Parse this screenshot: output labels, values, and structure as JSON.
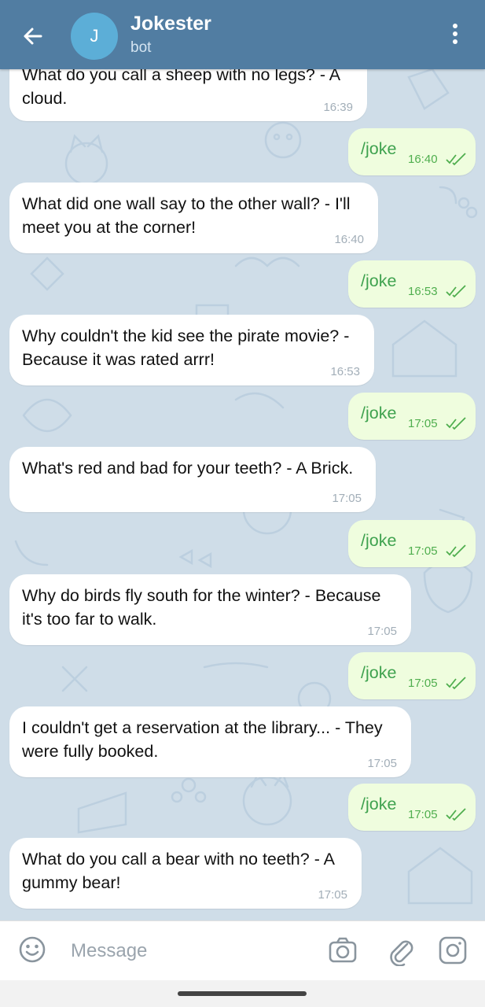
{
  "header": {
    "back_icon": "arrow-left-icon",
    "avatar_letter": "J",
    "title": "Jokester",
    "subtitle": "bot",
    "menu_icon": "more-vertical-icon",
    "color": "#517da2"
  },
  "messages": [
    {
      "type": "in",
      "text": "What do you call a sheep with no legs? - A cloud.",
      "time": "16:39"
    },
    {
      "type": "out",
      "text": "/joke",
      "time": "16:40"
    },
    {
      "type": "in",
      "text": "What did one wall say to the other wall? - I'll meet you at the corner!",
      "time": "16:40"
    },
    {
      "type": "out",
      "text": "/joke",
      "time": "16:53"
    },
    {
      "type": "in",
      "text": "Why couldn't the kid see the pirate movie? - Because it was rated arrr!",
      "time": "16:53"
    },
    {
      "type": "out",
      "text": "/joke",
      "time": "17:05"
    },
    {
      "type": "in",
      "text": "What's red and bad for your teeth? - A Brick.",
      "time": "17:05"
    },
    {
      "type": "out",
      "text": "/joke",
      "time": "17:05"
    },
    {
      "type": "in",
      "text": "Why do birds fly south for the winter? - Because it's too far to walk.",
      "time": "17:05"
    },
    {
      "type": "out",
      "text": "/joke",
      "time": "17:05"
    },
    {
      "type": "in",
      "text": "I couldn't get a reservation at the library... - They were fully booked.",
      "time": "17:05"
    },
    {
      "type": "out",
      "text": "/joke",
      "time": "17:05"
    },
    {
      "type": "in",
      "text": "What do you call a bear with no teeth? - A gummy bear!",
      "time": "17:05"
    }
  ],
  "composer": {
    "placeholder": "Message",
    "emoji_icon": "emoji-icon",
    "camera_icon": "camera-icon",
    "attach_icon": "paperclip-icon",
    "instagram_icon": "instagram-icon"
  },
  "colors": {
    "outgoing_bubble": "#effdde",
    "outgoing_text": "#3fa24f",
    "chat_background": "#cfdde8"
  }
}
